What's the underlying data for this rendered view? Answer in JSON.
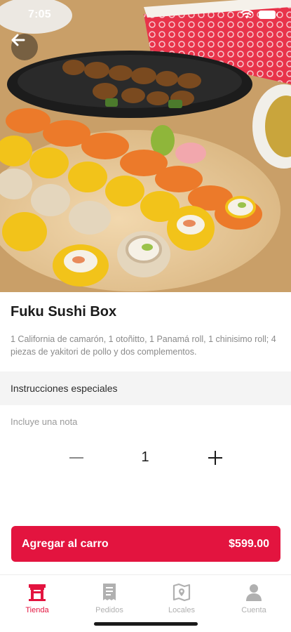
{
  "status_bar": {
    "time": "7:05"
  },
  "product": {
    "title": "Fuku Sushi Box",
    "description": "1 California de camarón, 1 otoñitto, 1 Panamá roll, 1 chinisimo roll; 4 piezas de yakitori de pollo y dos complementos."
  },
  "instructions": {
    "label": "Instrucciones especiales",
    "placeholder": "Incluye una nota"
  },
  "quantity": {
    "value": "1"
  },
  "add_to_cart": {
    "label": "Agregar al carro",
    "price": "$599.00"
  },
  "tabs": [
    {
      "label": "Tienda",
      "icon": "store-icon",
      "active": true
    },
    {
      "label": "Pedidos",
      "icon": "receipt-icon",
      "active": false
    },
    {
      "label": "Locales",
      "icon": "map-icon",
      "active": false
    },
    {
      "label": "Cuenta",
      "icon": "user-icon",
      "active": false
    }
  ],
  "colors": {
    "accent": "#e3143f",
    "inactive": "#b0b0b0"
  }
}
